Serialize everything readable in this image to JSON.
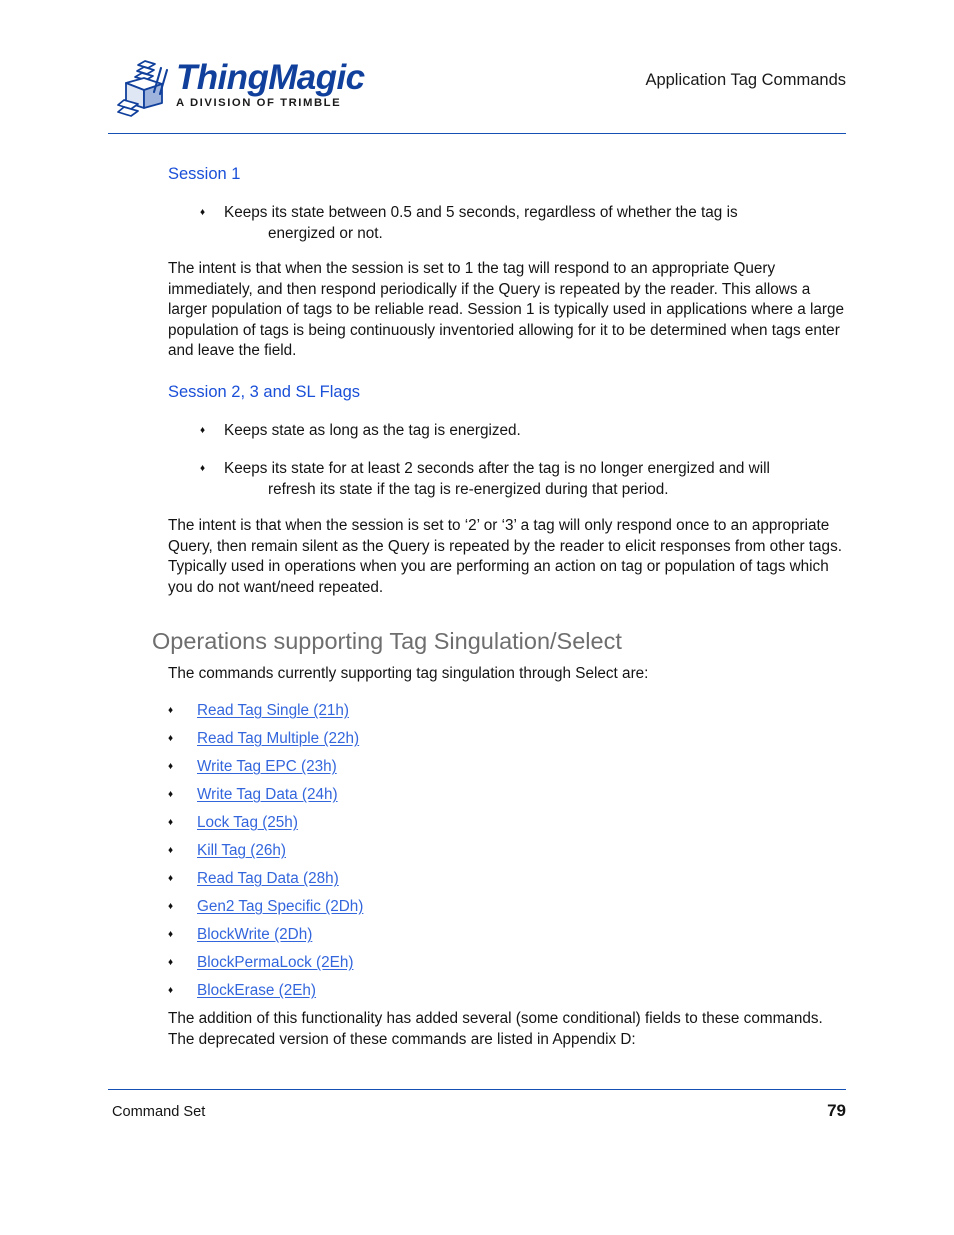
{
  "header": {
    "logo": {
      "wordmark": "ThingMagic",
      "tagline": "A DIVISION OF TRIMBLE",
      "mark_icon": "stacked-cube-logo-icon"
    },
    "title": "Application Tag Commands"
  },
  "colors": {
    "rule_blue": "#1551b5",
    "heading_blue": "#1a4fd8",
    "link_blue": "#3366dd",
    "section_gray": "#6e6e6e",
    "logo_blue": "#11409c",
    "body_text": "#141414"
  },
  "content": {
    "session1": {
      "heading": "Session 1",
      "bullets": [
        {
          "glyph": "♦",
          "text": "Keeps its state between 0.5 and 5 seconds, regardless of whether the tag is",
          "cont": "energized or not."
        }
      ],
      "paragraph": "The intent is that when the session is set to 1 the tag will respond to an appropriate Query immediately, and then respond periodically if the Query is repeated by the reader. This allows a larger population of tags to be reliable read. Session 1 is typically used in applications where a large population of tags is being continuously inventoried allowing for it to be determined when tags enter and leave the field."
    },
    "session23": {
      "heading": "Session 2, 3 and SL Flags",
      "bullet1": {
        "glyph": "♦",
        "text": "Keeps state as long as the tag is energized."
      },
      "bullet2": {
        "glyph": "♦",
        "text": "Keeps its state for at least 2 seconds after the tag is no longer energized and will",
        "cont": "refresh its state if the tag is re-energized during that period."
      },
      "paragraph": "The intent is that when the session is set to ‘2’ or ‘3’ a tag will only respond once to an appropriate Query, then remain silent as the Query is repeated by the reader to elicit responses from other tags. Typically used in operations when you are performing an action on tag or population of tags which you do not want/need repeated."
    },
    "operations": {
      "heading": "Operations supporting Tag Singulation/Select",
      "intro": "The commands currently supporting tag singulation through Select are:",
      "bullet_glyph": "♦",
      "links": [
        {
          "label": "Read Tag Single (21h)"
        },
        {
          "label": "Read Tag Multiple (22h)"
        },
        {
          "label": "Write Tag EPC (23h)"
        },
        {
          "label": "Write Tag Data (24h)"
        },
        {
          "label": "Lock Tag (25h)"
        },
        {
          "label": "Kill Tag (26h)"
        },
        {
          "label": "Read Tag Data (28h)"
        },
        {
          "label": "Gen2 Tag Specific (2Dh)"
        },
        {
          "label": "BlockWrite (2Dh)"
        },
        {
          "label": "BlockPermaLock (2Eh)"
        },
        {
          "label": "BlockErase (2Eh)"
        }
      ],
      "closing": "The addition of this functionality has added several (some conditional) fields to these commands. The deprecated version of these commands are listed in Appendix D:"
    }
  },
  "footer": {
    "left": "Command Set",
    "page_number": "79"
  }
}
